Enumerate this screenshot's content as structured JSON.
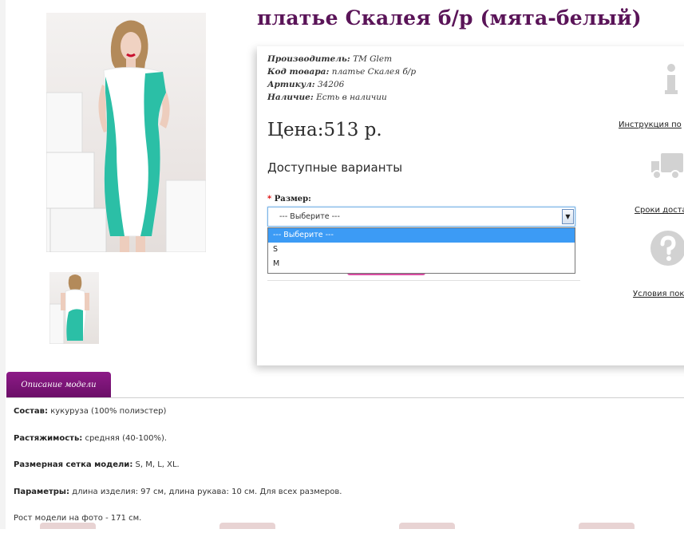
{
  "product": {
    "title": "платье Скалея б/р (мята-белый)",
    "meta": [
      {
        "label": "Производитель:",
        "value": "TM Glem"
      },
      {
        "label": "Код товара:",
        "value": "платье Скалея б/р"
      },
      {
        "label": "Артикул:",
        "value": "34206"
      },
      {
        "label": "Наличие:",
        "value": "Есть в наличии"
      }
    ],
    "price": "Цена:513 р."
  },
  "options": {
    "title": "Доступные варианты",
    "size_required": "*",
    "size_label": "Размер:",
    "select_value": "--- Выберите ---",
    "dropdown": [
      "--- Выберите ---",
      "S",
      "M"
    ]
  },
  "side_links": {
    "instructions": "Инструкция по",
    "delivery": "Сроки доста",
    "conditions": "Условия пок"
  },
  "icons": {
    "info": "info-icon",
    "truck": "truck-icon",
    "question": "question-icon",
    "select_arrow": "▼"
  },
  "tabs": {
    "description": "Описание модели"
  },
  "description": [
    {
      "label": "Состав:",
      "value": " кукуруза (100% полиэстер)"
    },
    {
      "label": "Растяжимость:",
      "value": " средняя (40-100%)."
    },
    {
      "label": "Размерная сетка модели:",
      "value": " S, M, L, XL."
    },
    {
      "label": "Параметры:",
      "value": " длина изделия: 97 см, длина рукава: 10 см. Для всех размеров."
    },
    {
      "label": "",
      "value": "Рост модели на фото - 171 см."
    }
  ],
  "colors": {
    "title": "#5a1458",
    "tab": "#7a1476",
    "mint": "#2bbfa6",
    "dropdown_selected": "#3c9bf5"
  }
}
